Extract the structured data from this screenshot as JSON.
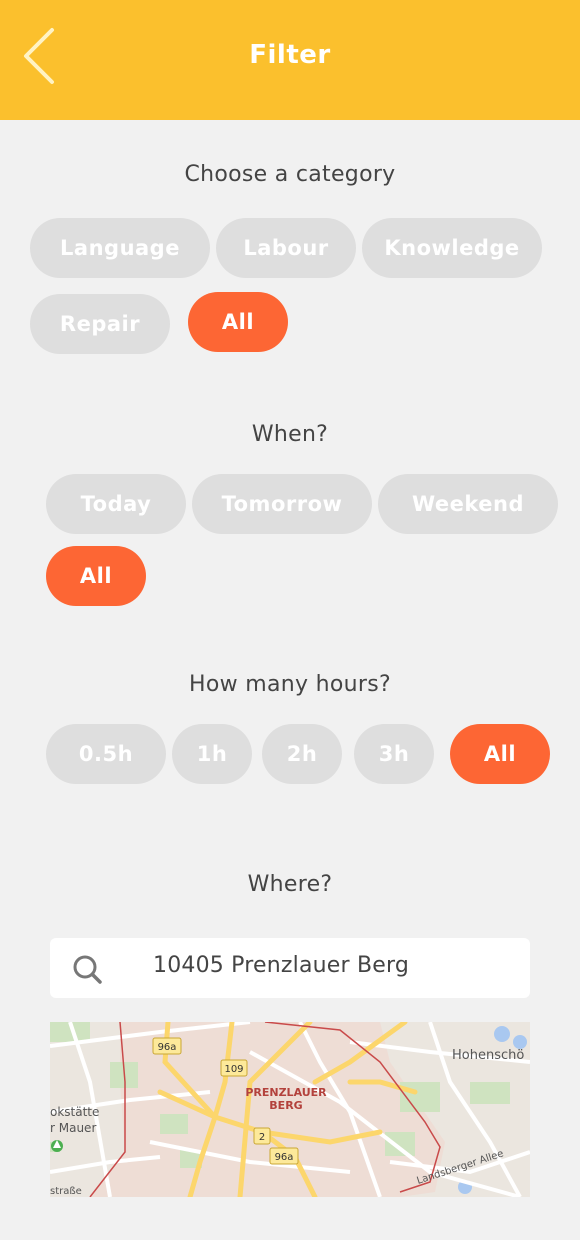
{
  "header": {
    "title": "Filter",
    "back_icon": "chevron-left-icon"
  },
  "category": {
    "title": "Choose a category",
    "options": [
      "Language",
      "Labour",
      "Knowledge",
      "Repair",
      "All"
    ],
    "selected": "All"
  },
  "when": {
    "title": "When?",
    "options": [
      "Today",
      "Tomorrow",
      "Weekend",
      "All"
    ],
    "selected": "All"
  },
  "hours": {
    "title": "How many hours?",
    "options": [
      "0.5h",
      "1h",
      "2h",
      "3h",
      "All"
    ],
    "selected": "All"
  },
  "where": {
    "title": "Where?",
    "search_icon": "search-icon",
    "location_value": "10405 Prenzlauer Berg"
  },
  "map": {
    "district_label_line1": "PRENZLAUER",
    "district_label_line2": "BERG",
    "place_hohenschoen": "Hohenschö",
    "place_west_line1": "okstätte",
    "place_west_line2": "r Mauer",
    "street_landsberger": "Landsberger Allee",
    "street_bottom_left": "straße",
    "road_badges": [
      "96a",
      "109",
      "2",
      "96a"
    ]
  },
  "colors": {
    "header": "#fbc02d",
    "accent": "#fd6634",
    "chip_inactive": "#dedede",
    "background": "#f1f1f1"
  }
}
